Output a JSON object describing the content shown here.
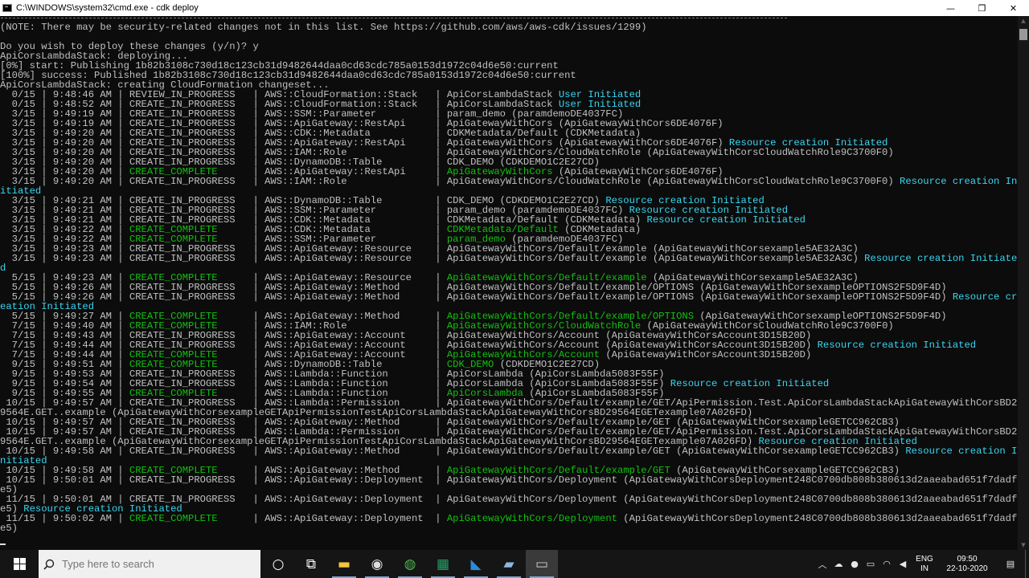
{
  "window": {
    "title": "C:\\WINDOWS\\system32\\cmd.exe - cdk  deploy",
    "minimize_icon": "—",
    "maximize_icon": "❐",
    "close_icon": "✕"
  },
  "colors": {
    "background": "#0c0c0c",
    "text": "#c0c0c0",
    "complete_green": "#13c010",
    "info_cyan": "#3ad6f0",
    "taskbar": "#151515"
  },
  "console": {
    "lines": [
      [
        {
          "t": "(NOTE: There may be security-related changes not in this list. See https://github.com/aws/aws-cdk/issues/1299)"
        }
      ],
      [
        {
          "t": ""
        }
      ],
      [
        {
          "t": "Do you wish to deploy these changes (y/n)? y"
        }
      ],
      [
        {
          "t": "ApiCorsLambdaStack: deploying..."
        }
      ],
      [
        {
          "t": "[0%] start: Publishing 1b82b3108c730d18c123cb31d9482644daa0cd63cdc785a0153d1972c04d6e50:current"
        }
      ],
      [
        {
          "t": "[100%] success: Published 1b82b3108c730d18c123cb31d9482644daa0cd63cdc785a0153d1972c04d6e50:current"
        }
      ],
      [
        {
          "t": "ApiCorsLambdaStack: creating CloudFormation changeset..."
        }
      ],
      [
        {
          "t": "  0/15 | 9:48:46 AM | REVIEW_IN_PROGRESS   | AWS::CloudFormation::Stack   | ApiCorsLambdaStack "
        },
        {
          "t": "User Initiated",
          "c": "c"
        }
      ],
      [
        {
          "t": "  0/15 | 9:48:52 AM | CREATE_IN_PROGRESS   | AWS::CloudFormation::Stack   | ApiCorsLambdaStack "
        },
        {
          "t": "User Initiated",
          "c": "c"
        }
      ],
      [
        {
          "t": "  3/15 | 9:49:19 AM | CREATE_IN_PROGRESS   | AWS::SSM::Parameter          | param_demo (paramdemoDE4037FC)"
        }
      ],
      [
        {
          "t": "  3/15 | 9:49:19 AM | CREATE_IN_PROGRESS   | AWS::ApiGateway::RestApi     | ApiGatewayWithCors (ApiGatewayWithCors6DE4076F)"
        }
      ],
      [
        {
          "t": "  3/15 | 9:49:20 AM | CREATE_IN_PROGRESS   | AWS::CDK::Metadata           | CDKMetadata/Default (CDKMetadata)"
        }
      ],
      [
        {
          "t": "  3/15 | 9:49:20 AM | CREATE_IN_PROGRESS   | AWS::ApiGateway::RestApi     | ApiGatewayWithCors (ApiGatewayWithCors6DE4076F) "
        },
        {
          "t": "Resource creation Initiated",
          "c": "c"
        }
      ],
      [
        {
          "t": "  3/15 | 9:49:20 AM | CREATE_IN_PROGRESS   | AWS::IAM::Role               | ApiGatewayWithCors/CloudWatchRole (ApiGatewayWithCorsCloudWatchRole9C3700F0)"
        }
      ],
      [
        {
          "t": "  3/15 | 9:49:20 AM | CREATE_IN_PROGRESS   | AWS::DynamoDB::Table         | CDK_DEMO (CDKDEMO1C2E27CD)"
        }
      ],
      [
        {
          "t": "  3/15 | 9:49:20 AM | "
        },
        {
          "t": "CREATE_COMPLETE",
          "c": "g"
        },
        {
          "t": "      | AWS::ApiGateway::RestApi     | "
        },
        {
          "t": "ApiGatewayWithCors",
          "c": "g"
        },
        {
          "t": " (ApiGatewayWithCors6DE4076F)"
        }
      ],
      [
        {
          "t": "  3/15 | 9:49:20 AM | CREATE_IN_PROGRESS   | AWS::IAM::Role               | ApiGatewayWithCors/CloudWatchRole (ApiGatewayWithCorsCloudWatchRole9C3700F0) "
        },
        {
          "t": "Resource creation In",
          "c": "c"
        }
      ],
      [
        {
          "t": "itiated",
          "c": "c"
        }
      ],
      [
        {
          "t": "  3/15 | 9:49:21 AM | CREATE_IN_PROGRESS   | AWS::DynamoDB::Table         | CDK_DEMO (CDKDEMO1C2E27CD) "
        },
        {
          "t": "Resource creation Initiated",
          "c": "c"
        }
      ],
      [
        {
          "t": "  3/15 | 9:49:21 AM | CREATE_IN_PROGRESS   | AWS::SSM::Parameter          | param_demo (paramdemoDE4037FC) "
        },
        {
          "t": "Resource creation Initiated",
          "c": "c"
        }
      ],
      [
        {
          "t": "  3/15 | 9:49:21 AM | CREATE_IN_PROGRESS   | AWS::CDK::Metadata           | CDKMetadata/Default (CDKMetadata) "
        },
        {
          "t": "Resource creation Initiated",
          "c": "c"
        }
      ],
      [
        {
          "t": "  3/15 | 9:49:22 AM | "
        },
        {
          "t": "CREATE_COMPLETE",
          "c": "g"
        },
        {
          "t": "      | AWS::CDK::Metadata           | "
        },
        {
          "t": "CDKMetadata/Default",
          "c": "g"
        },
        {
          "t": " (CDKMetadata)"
        }
      ],
      [
        {
          "t": "  3/15 | 9:49:22 AM | "
        },
        {
          "t": "CREATE_COMPLETE",
          "c": "g"
        },
        {
          "t": "      | AWS::SSM::Parameter          | "
        },
        {
          "t": "param_demo",
          "c": "g"
        },
        {
          "t": " (paramdemoDE4037FC)"
        }
      ],
      [
        {
          "t": "  3/15 | 9:49:23 AM | CREATE_IN_PROGRESS   | AWS::ApiGateway::Resource    | ApiGatewayWithCors/Default/example (ApiGatewayWithCorsexample5AE32A3C)"
        }
      ],
      [
        {
          "t": "  3/15 | 9:49:23 AM | CREATE_IN_PROGRESS   | AWS::ApiGateway::Resource    | ApiGatewayWithCors/Default/example (ApiGatewayWithCorsexample5AE32A3C) "
        },
        {
          "t": "Resource creation Initiate",
          "c": "c"
        }
      ],
      [
        {
          "t": "d",
          "c": "c"
        }
      ],
      [
        {
          "t": "  5/15 | 9:49:23 AM | "
        },
        {
          "t": "CREATE_COMPLETE",
          "c": "g"
        },
        {
          "t": "      | AWS::ApiGateway::Resource    | "
        },
        {
          "t": "ApiGatewayWithCors/Default/example",
          "c": "g"
        },
        {
          "t": " (ApiGatewayWithCorsexample5AE32A3C)"
        }
      ],
      [
        {
          "t": "  5/15 | 9:49:26 AM | CREATE_IN_PROGRESS   | AWS::ApiGateway::Method      | ApiGatewayWithCors/Default/example/OPTIONS (ApiGatewayWithCorsexampleOPTIONS2F5D9F4D)"
        }
      ],
      [
        {
          "t": "  5/15 | 9:49:26 AM | CREATE_IN_PROGRESS   | AWS::ApiGateway::Method      | ApiGatewayWithCors/Default/example/OPTIONS (ApiGatewayWithCorsexampleOPTIONS2F5D9F4D) "
        },
        {
          "t": "Resource cr",
          "c": "c"
        }
      ],
      [
        {
          "t": "eation Initiated",
          "c": "c"
        }
      ],
      [
        {
          "t": "  5/15 | 9:49:27 AM | "
        },
        {
          "t": "CREATE_COMPLETE",
          "c": "g"
        },
        {
          "t": "      | AWS::ApiGateway::Method      | "
        },
        {
          "t": "ApiGatewayWithCors/Default/example/OPTIONS",
          "c": "g"
        },
        {
          "t": " (ApiGatewayWithCorsexampleOPTIONS2F5D9F4D)"
        }
      ],
      [
        {
          "t": "  7/15 | 9:49:40 AM | "
        },
        {
          "t": "CREATE_COMPLETE",
          "c": "g"
        },
        {
          "t": "      | AWS::IAM::Role               | "
        },
        {
          "t": "ApiGatewayWithCors/CloudWatchRole",
          "c": "g"
        },
        {
          "t": " (ApiGatewayWithCorsCloudWatchRole9C3700F0)"
        }
      ],
      [
        {
          "t": "  7/15 | 9:49:43 AM | CREATE_IN_PROGRESS   | AWS::ApiGateway::Account     | ApiGatewayWithCors/Account (ApiGatewayWithCorsAccount3D15B20D)"
        }
      ],
      [
        {
          "t": "  7/15 | 9:49:44 AM | CREATE_IN_PROGRESS   | AWS::ApiGateway::Account     | ApiGatewayWithCors/Account (ApiGatewayWithCorsAccount3D15B20D) "
        },
        {
          "t": "Resource creation Initiated",
          "c": "c"
        }
      ],
      [
        {
          "t": "  7/15 | 9:49:44 AM | "
        },
        {
          "t": "CREATE_COMPLETE",
          "c": "g"
        },
        {
          "t": "      | AWS::ApiGateway::Account     | "
        },
        {
          "t": "ApiGatewayWithCors/Account",
          "c": "g"
        },
        {
          "t": " (ApiGatewayWithCorsAccount3D15B20D)"
        }
      ],
      [
        {
          "t": "  9/15 | 9:49:51 AM | "
        },
        {
          "t": "CREATE_COMPLETE",
          "c": "g"
        },
        {
          "t": "      | AWS::DynamoDB::Table         | "
        },
        {
          "t": "CDK_DEMO",
          "c": "g"
        },
        {
          "t": " (CDKDEMO1C2E27CD)"
        }
      ],
      [
        {
          "t": "  9/15 | 9:49:53 AM | CREATE_IN_PROGRESS   | AWS::Lambda::Function        | ApiCorsLambda (ApiCorsLambda5083F55F)"
        }
      ],
      [
        {
          "t": "  9/15 | 9:49:54 AM | CREATE_IN_PROGRESS   | AWS::Lambda::Function        | ApiCorsLambda (ApiCorsLambda5083F55F) "
        },
        {
          "t": "Resource creation Initiated",
          "c": "c"
        }
      ],
      [
        {
          "t": "  9/15 | 9:49:55 AM | "
        },
        {
          "t": "CREATE_COMPLETE",
          "c": "g"
        },
        {
          "t": "      | AWS::Lambda::Function        | "
        },
        {
          "t": "ApiCorsLambda",
          "c": "g"
        },
        {
          "t": " (ApiCorsLambda5083F55F)"
        }
      ],
      [
        {
          "t": " 10/15 | 9:49:57 AM | CREATE_IN_PROGRESS   | AWS::Lambda::Permission      | ApiGatewayWithCors/Default/example/GET/ApiPermission.Test.ApiCorsLambdaStackApiGatewayWithCorsBD2"
        }
      ],
      [
        {
          "t": "9564E.GET..example (ApiGatewayWithCorsexampleGETApiPermissionTestApiCorsLambdaStackApiGatewayWithCorsBD29564EGETexample07A026FD)"
        }
      ],
      [
        {
          "t": " 10/15 | 9:49:57 AM | CREATE_IN_PROGRESS   | AWS::ApiGateway::Method      | ApiGatewayWithCors/Default/example/GET (ApiGatewayWithCorsexampleGETCC962CB3)"
        }
      ],
      [
        {
          "t": " 10/15 | 9:49:57 AM | CREATE_IN_PROGRESS   | AWS::Lambda::Permission      | ApiGatewayWithCors/Default/example/GET/ApiPermission.Test.ApiCorsLambdaStackApiGatewayWithCorsBD2"
        }
      ],
      [
        {
          "t": "9564E.GET..example (ApiGatewayWithCorsexampleGETApiPermissionTestApiCorsLambdaStackApiGatewayWithCorsBD29564EGETexample07A026FD) "
        },
        {
          "t": "Resource creation Initiated",
          "c": "c"
        }
      ],
      [
        {
          "t": " 10/15 | 9:49:58 AM | CREATE_IN_PROGRESS   | AWS::ApiGateway::Method      | ApiGatewayWithCors/Default/example/GET (ApiGatewayWithCorsexampleGETCC962CB3) "
        },
        {
          "t": "Resource creation I",
          "c": "c"
        }
      ],
      [
        {
          "t": "nitiated",
          "c": "c"
        }
      ],
      [
        {
          "t": " 10/15 | 9:49:58 AM | "
        },
        {
          "t": "CREATE_COMPLETE",
          "c": "g"
        },
        {
          "t": "      | AWS::ApiGateway::Method      | "
        },
        {
          "t": "ApiGatewayWithCors/Default/example/GET",
          "c": "g"
        },
        {
          "t": " (ApiGatewayWithCorsexampleGETCC962CB3)"
        }
      ],
      [
        {
          "t": " 10/15 | 9:50:01 AM | CREATE_IN_PROGRESS   | AWS::ApiGateway::Deployment  | ApiGatewayWithCors/Deployment (ApiGatewayWithCorsDeployment248C0700db808b380613d2aaeabad651f7dadf"
        }
      ],
      [
        {
          "t": "e5)"
        }
      ],
      [
        {
          "t": " 11/15 | 9:50:01 AM | CREATE_IN_PROGRESS   | AWS::ApiGateway::Deployment  | ApiGatewayWithCors/Deployment (ApiGatewayWithCorsDeployment248C0700db808b380613d2aaeabad651f7dadf"
        }
      ],
      [
        {
          "t": "e5) "
        },
        {
          "t": "Resource creation Initiated",
          "c": "c"
        }
      ],
      [
        {
          "t": " 11/15 | 9:50:02 AM | "
        },
        {
          "t": "CREATE_COMPLETE",
          "c": "g"
        },
        {
          "t": "      | AWS::ApiGateway::Deployment  | "
        },
        {
          "t": "ApiGatewayWithCors/Deployment",
          "c": "g"
        },
        {
          "t": " (ApiGatewayWithCorsDeployment248C0700db808b380613d2aaeabad651f7dadf"
        }
      ],
      [
        {
          "t": "e5)"
        }
      ]
    ]
  },
  "taskbar": {
    "search_placeholder": "Type here to search",
    "search_icon": "search-icon",
    "start_icon": "windows-logo-icon",
    "pinned": [
      {
        "name": "cortana-icon",
        "glyph": "○"
      },
      {
        "name": "task-view-icon",
        "glyph": "⧉"
      },
      {
        "name": "file-explorer-icon",
        "glyph": "▬"
      },
      {
        "name": "obs-icon",
        "glyph": "◉"
      },
      {
        "name": "chrome-icon",
        "glyph": "◍"
      },
      {
        "name": "excel-icon",
        "glyph": "▦"
      },
      {
        "name": "vscode-icon",
        "glyph": "◣"
      },
      {
        "name": "notepad-icon",
        "glyph": "▰"
      },
      {
        "name": "cmd-icon",
        "glyph": "▭"
      }
    ],
    "tray": {
      "chevron": "︿",
      "cloud": "☁",
      "mic": "●",
      "battery": "▭",
      "network": "◠",
      "volume": "◀",
      "lang_line1": "ENG",
      "lang_line2": "IN",
      "time": "09:50",
      "date": "22-10-2020",
      "notification_icon": "▤"
    }
  }
}
